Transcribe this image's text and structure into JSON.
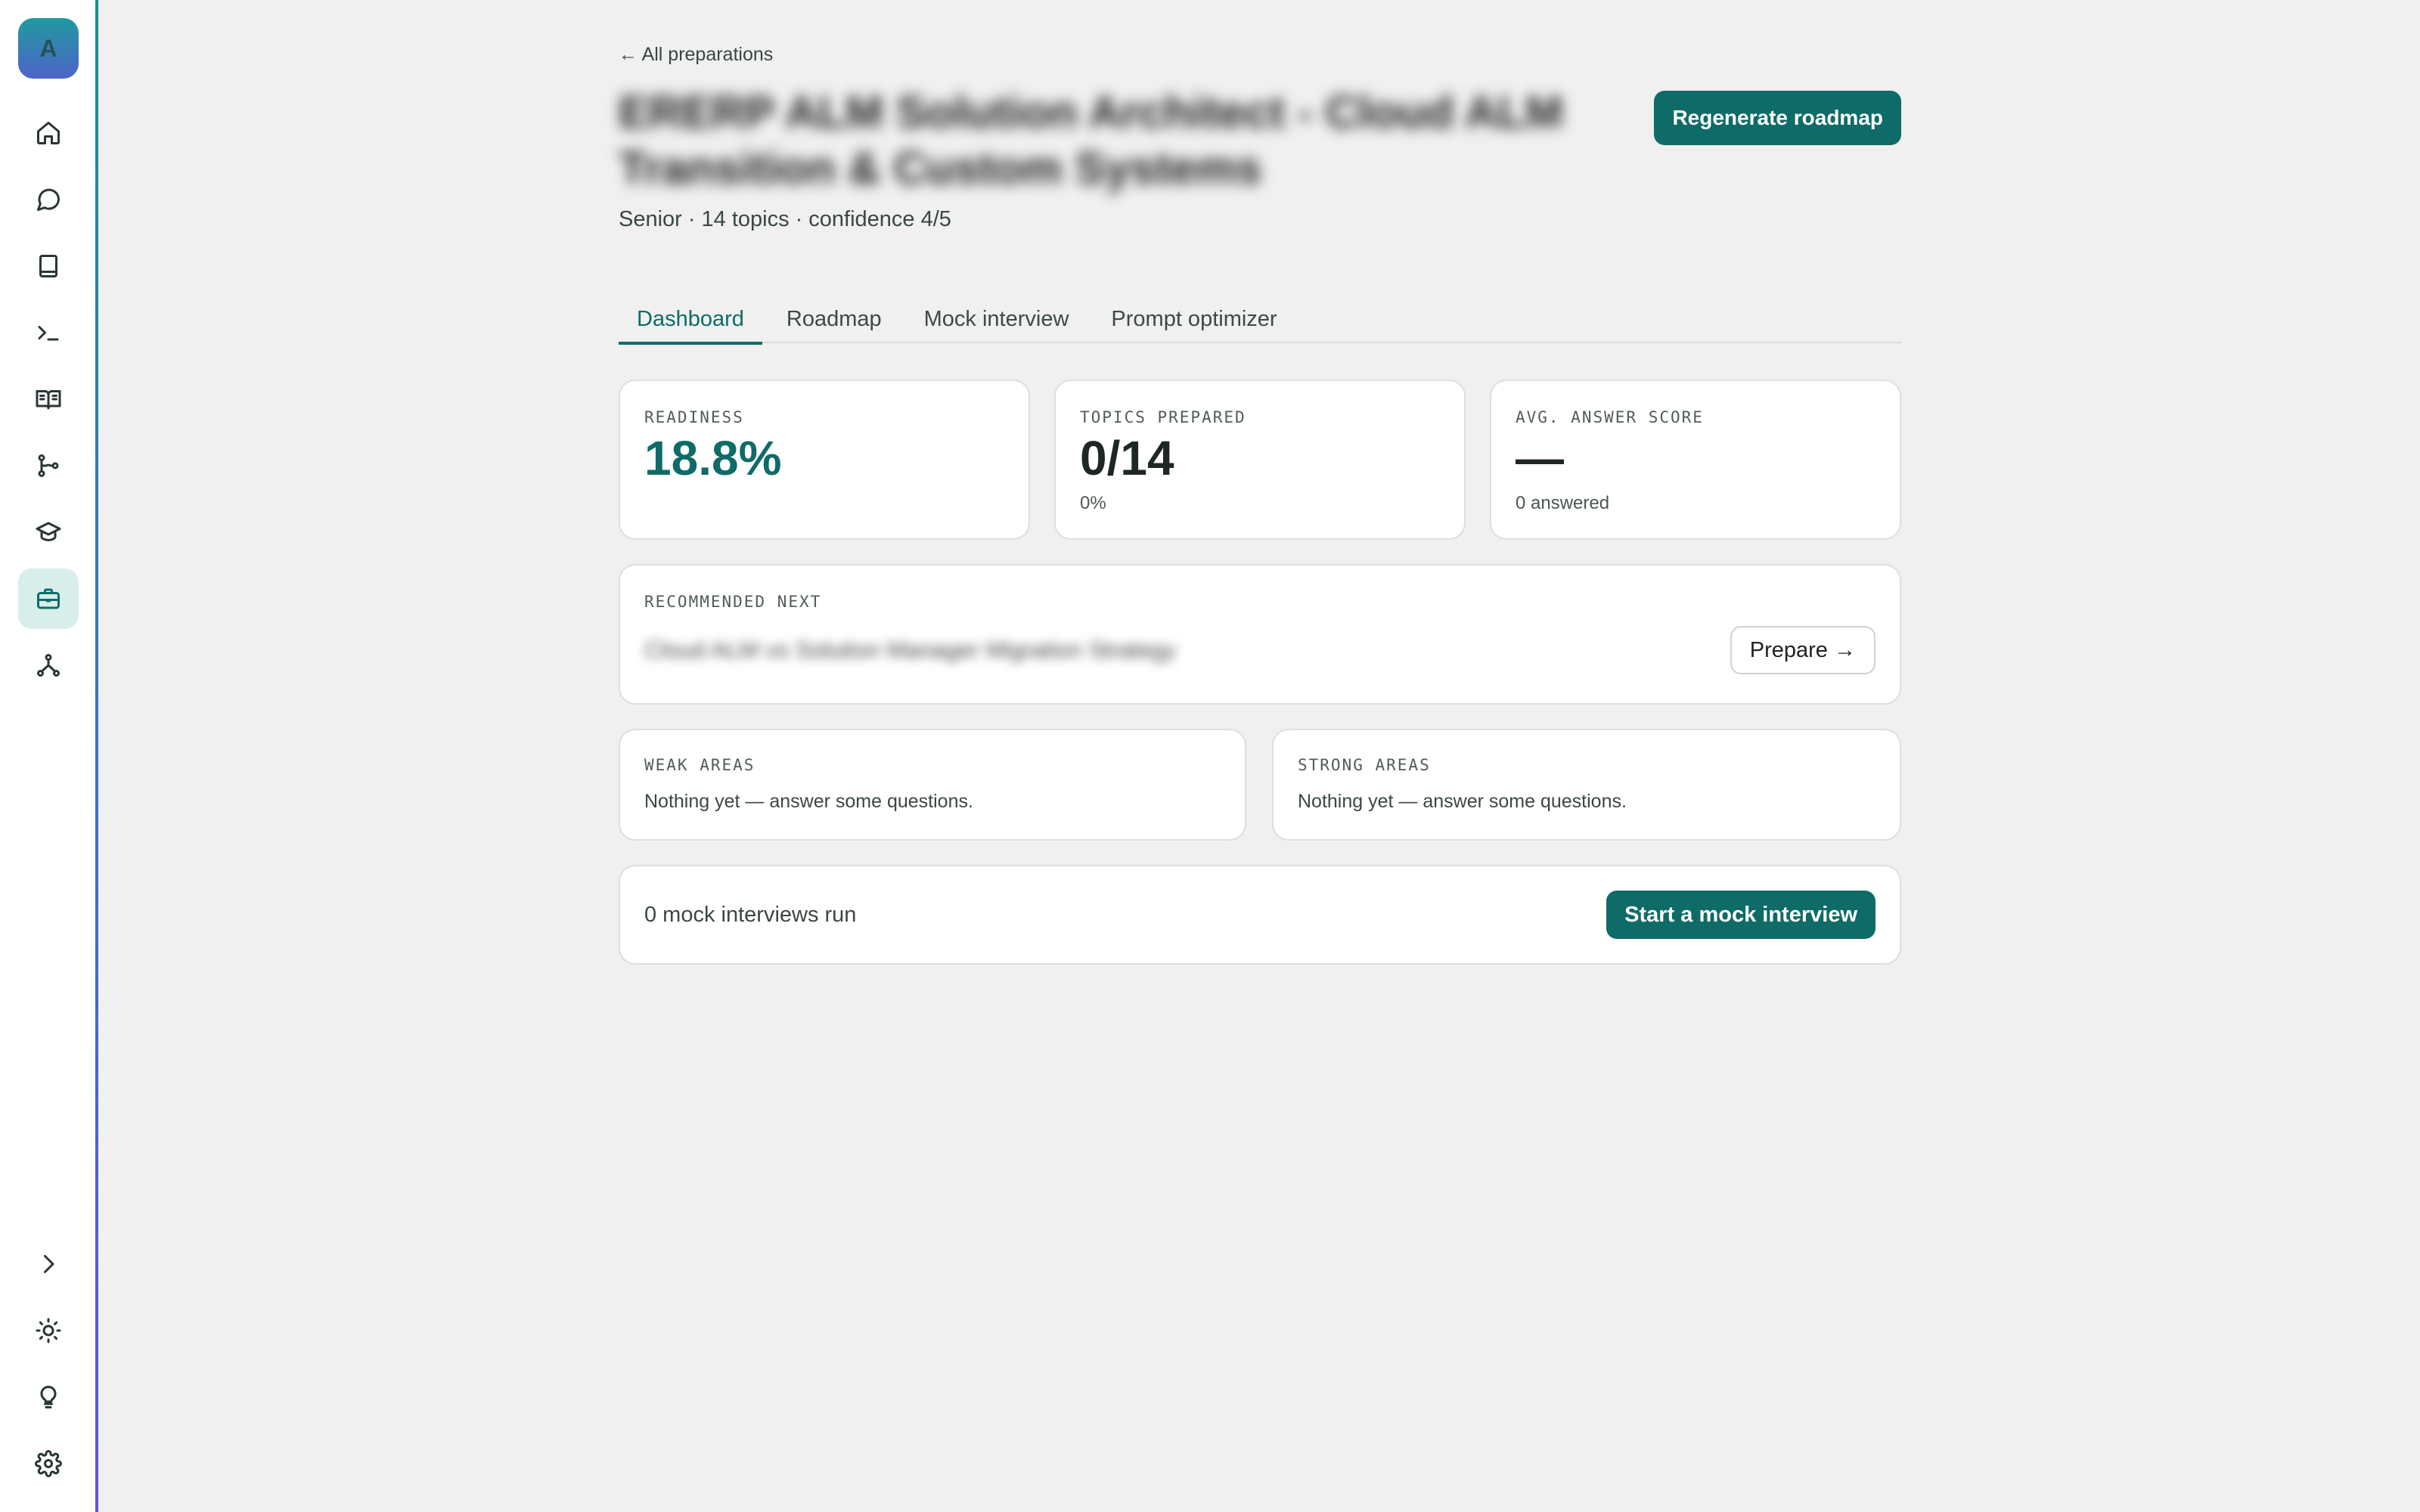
{
  "sidebar": {
    "avatar_letter": "A",
    "nav": [
      {
        "icon": "home-icon"
      },
      {
        "icon": "chat-icon"
      },
      {
        "icon": "notebook-icon"
      },
      {
        "icon": "terminal-icon"
      },
      {
        "icon": "book-open-icon"
      },
      {
        "icon": "workflow-icon"
      },
      {
        "icon": "graduation-cap-icon"
      },
      {
        "icon": "briefcase-icon",
        "active": true
      },
      {
        "icon": "network-icon"
      }
    ],
    "bottom": [
      {
        "icon": "chevron-right-icon"
      },
      {
        "icon": "sun-icon"
      },
      {
        "icon": "lightbulb-icon"
      },
      {
        "icon": "gear-icon"
      }
    ]
  },
  "header": {
    "back_label": "← All preparations",
    "title": "ERERP ALM Solution Architect - Cloud ALM Transition & Custom Systems",
    "regenerate_label": "Regenerate roadmap",
    "level": "Senior",
    "topics": "14 topics",
    "confidence": "confidence 4/5"
  },
  "tabs": [
    "Dashboard",
    "Roadmap",
    "Mock interview",
    "Prompt optimizer"
  ],
  "stats": {
    "readiness": {
      "label": "READINESS",
      "value": "18.8%"
    },
    "topics_prepared": {
      "label": "TOPICS PREPARED",
      "value": "0/14",
      "sub": "0%"
    },
    "avg_score": {
      "label": "AVG. ANSWER SCORE",
      "value": "—",
      "sub": "0 answered"
    }
  },
  "recommended": {
    "label": "RECOMMENDED NEXT",
    "topic": "Cloud ALM vs Solution Manager Migration Strategy",
    "prepare_label": "Prepare →"
  },
  "weak_areas": {
    "label": "WEAK AREAS",
    "text": "Nothing yet — answer some questions."
  },
  "strong_areas": {
    "label": "STRONG AREAS",
    "text": "Nothing yet — answer some questions."
  },
  "mock": {
    "count_text": "0 mock interviews run",
    "start_label": "Start a mock interview"
  },
  "colors": {
    "accent": "#0f6b67",
    "background": "#eff0ef",
    "card": "#ffffff"
  }
}
